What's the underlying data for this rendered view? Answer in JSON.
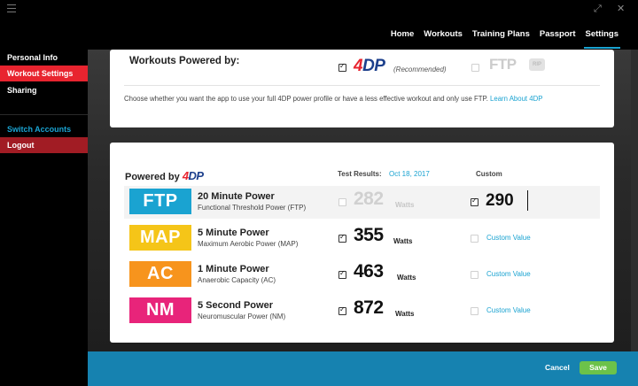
{
  "window": {
    "hamburger_icon": "hamburger-icon",
    "maximize_icon": "maximize-icon",
    "close_icon": "close-icon"
  },
  "nav": {
    "items": [
      {
        "label": "Home",
        "active": false
      },
      {
        "label": "Workouts",
        "active": false
      },
      {
        "label": "Training Plans",
        "active": false
      },
      {
        "label": "Passport",
        "active": false
      },
      {
        "label": "Settings",
        "active": true
      }
    ]
  },
  "sidebar": {
    "items": [
      {
        "label": "Personal Info"
      },
      {
        "label": "Workout Settings",
        "active": true
      },
      {
        "label": "Sharing"
      },
      {
        "label": "Switch Accounts"
      },
      {
        "label": "Logout"
      }
    ]
  },
  "powered_section": {
    "title": "Workouts Powered by:",
    "option_4dp": {
      "logo_4": "4",
      "logo_dp": "DP",
      "recommended": "(Recommended)",
      "checked": true
    },
    "option_ftp": {
      "label": "FTP",
      "badge": "RIP",
      "checked": false
    },
    "description": "Choose whether you want the app to use your full 4DP power profile or have a less effective workout and only use FTP.",
    "learn_link": "Learn About 4DP"
  },
  "profile_section": {
    "powered_by": "Powered by",
    "logo_4": "4",
    "logo_dp": "DP",
    "test_results_label": "Test Results:",
    "test_date": "Oct 18, 2017",
    "custom_label": "Custom",
    "rows": [
      {
        "badge": "FTP",
        "badge_color": "#1aa3d1",
        "title": "20 Minute Power",
        "subtitle": "Functional Threshold Power (FTP)",
        "test_value": "282",
        "test_checked": false,
        "custom_checked": true,
        "custom_value": "290",
        "watts": "Watts"
      },
      {
        "badge": "MAP",
        "badge_color": "#f5c518",
        "title": "5 Minute Power",
        "subtitle": "Maximum Aerobic Power (MAP)",
        "test_value": "355",
        "test_checked": true,
        "custom_checked": false,
        "custom_link": "Custom Value",
        "watts": "Watts"
      },
      {
        "badge": "AC",
        "badge_color": "#f7941d",
        "title": "1 Minute Power",
        "subtitle": "Anaerobic Capacity (AC)",
        "test_value": "463",
        "test_checked": true,
        "custom_checked": false,
        "custom_link": "Custom Value",
        "watts": "Watts"
      },
      {
        "badge": "NM",
        "badge_color": "#e8247a",
        "title": "5 Second Power",
        "subtitle": "Neuromuscular Power (NM)",
        "test_value": "872",
        "test_checked": true,
        "custom_checked": false,
        "custom_link": "Custom Value",
        "watts": "Watts"
      }
    ]
  },
  "footer": {
    "cancel_label": "Cancel",
    "save_label": "Save"
  }
}
